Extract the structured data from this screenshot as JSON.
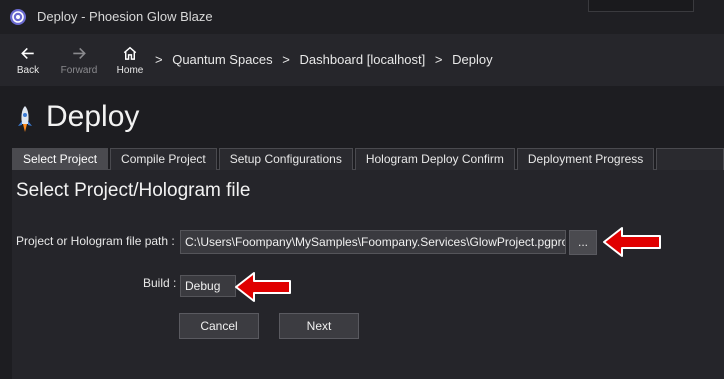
{
  "window": {
    "title": "Deploy - Phoesion Glow Blaze",
    "app_icon": "gear-cog-icon"
  },
  "nav": {
    "back_label": "Back",
    "forward_label": "Forward",
    "home_label": "Home",
    "breadcrumb": [
      "Quantum Spaces",
      "Dashboard [localhost]",
      "Deploy"
    ],
    "separator": ">"
  },
  "page": {
    "title": "Deploy",
    "icon": "rocket-icon"
  },
  "tabs": [
    {
      "label": "Select Project",
      "active": true
    },
    {
      "label": "Compile Project",
      "active": false
    },
    {
      "label": "Setup Configurations",
      "active": false
    },
    {
      "label": "Hologram Deploy Confirm",
      "active": false
    },
    {
      "label": "Deployment Progress",
      "active": false
    }
  ],
  "form": {
    "section_title": "Select Project/Hologram file",
    "path_label": "Project or Hologram file path :",
    "path_value": "C:\\Users\\Foompany\\MySamples\\Foompany.Services\\GlowProject.pgproj",
    "browse_label": "...",
    "build_label": "Build :",
    "build_value": "Debug",
    "cancel_label": "Cancel",
    "next_label": "Next"
  },
  "colors": {
    "background": "#1d1d21",
    "panel": "#25252a",
    "active_tab": "#4a4a4f",
    "annotation_arrow": "#e00000"
  }
}
